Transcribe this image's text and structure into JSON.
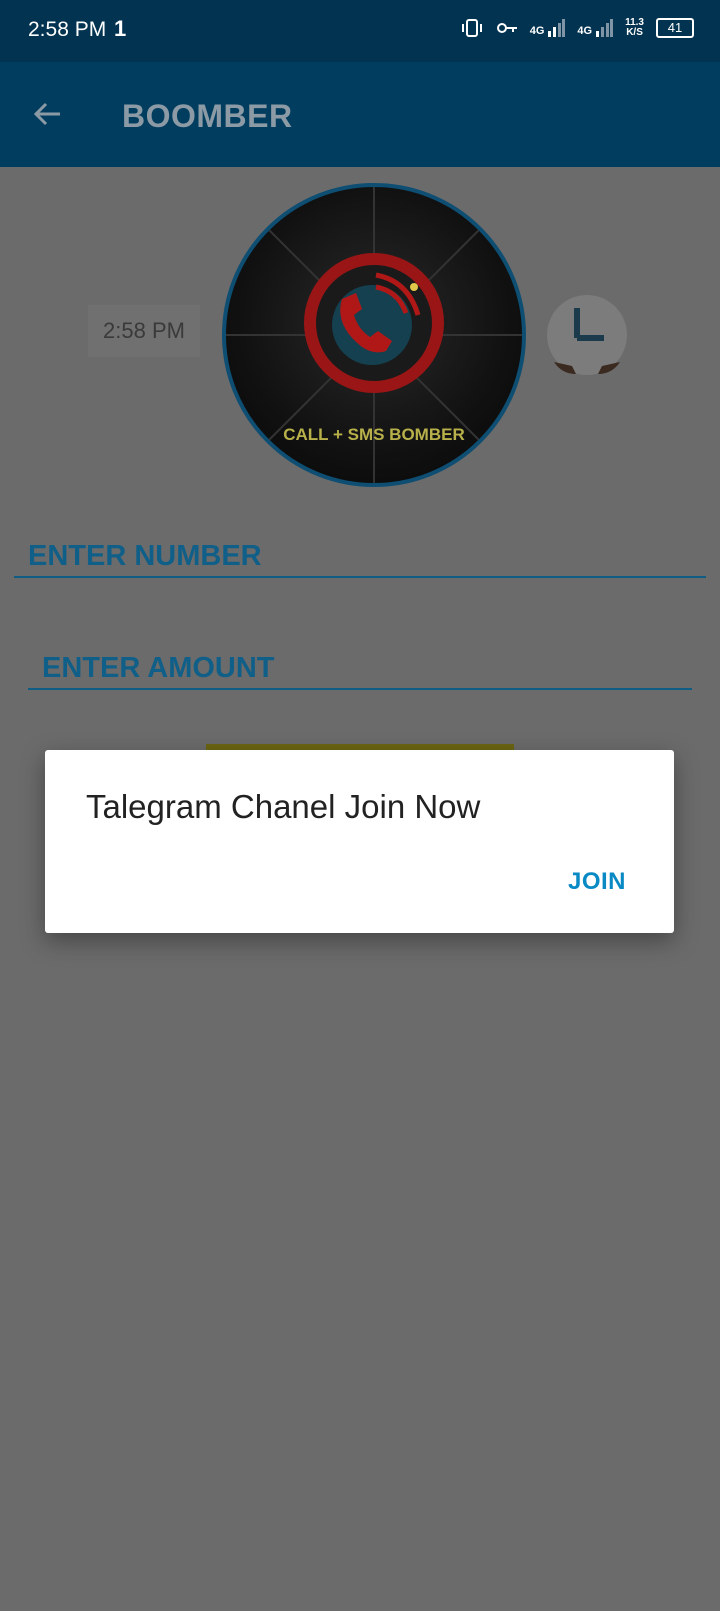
{
  "status_bar": {
    "time": "2:58 PM",
    "data_indicator": "1",
    "network1": "4G",
    "network2": "4G",
    "speed_value": "11.3",
    "speed_unit": "K/S",
    "battery": "41"
  },
  "toolbar": {
    "title": "BOOMBER"
  },
  "chat": {
    "time": "2:58 PM",
    "logo_caption": "CALL + SMS BOMBER"
  },
  "form": {
    "number_placeholder": "ENTER NUMBER",
    "amount_placeholder": "ENTER AMOUNT"
  },
  "dialog": {
    "message": "Talegram Chanel Join Now",
    "join_label": "JOIN"
  },
  "colors": {
    "statusbar": "#023350",
    "toolbar": "#013d5e",
    "accent": "#0a8ac4",
    "scrim": "#6b6b6b"
  }
}
